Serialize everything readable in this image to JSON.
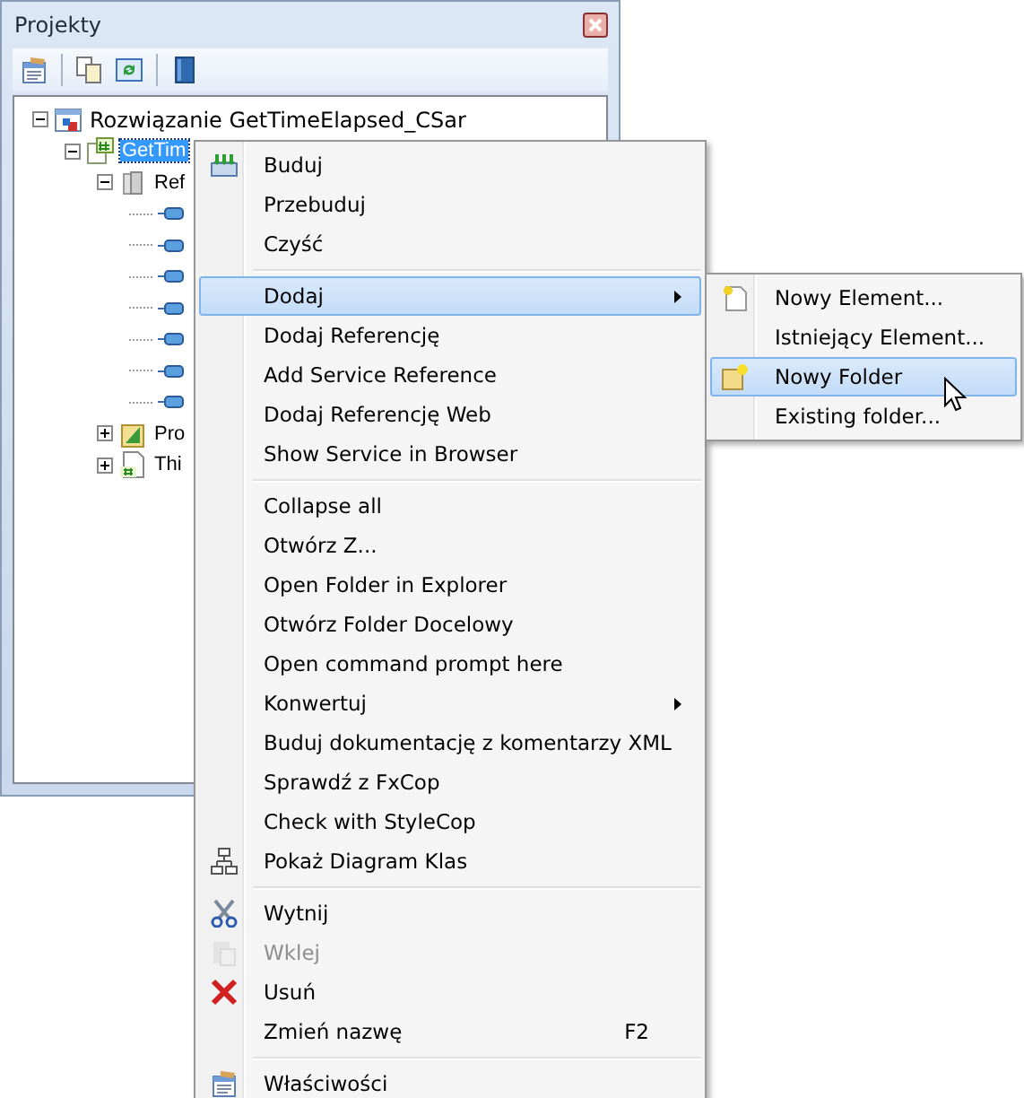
{
  "panel": {
    "title": "Projekty",
    "tree": [
      {
        "label": "Rozwiązanie GetTimeElapsed_CSar",
        "kind": "solution",
        "expanded": true,
        "selected": false,
        "children": [
          {
            "label": "GetTim",
            "kind": "project",
            "expanded": true,
            "selected": true,
            "children": [
              {
                "label": "Ref",
                "kind": "references",
                "expanded": true,
                "selected": false,
                "children": [
                  {
                    "kind": "reference"
                  },
                  {
                    "kind": "reference"
                  },
                  {
                    "kind": "reference"
                  },
                  {
                    "kind": "reference"
                  },
                  {
                    "kind": "reference"
                  },
                  {
                    "kind": "reference"
                  },
                  {
                    "kind": "reference"
                  }
                ]
              },
              {
                "label": "Pro",
                "kind": "properties",
                "expanded": false,
                "selected": false
              },
              {
                "label": "Thi",
                "kind": "file",
                "expanded": false,
                "selected": false
              }
            ]
          }
        ]
      }
    ]
  },
  "context_menu": [
    {
      "kind": "item",
      "label": "Buduj",
      "selected": false,
      "disabled": false,
      "submenu": false
    },
    {
      "kind": "item",
      "label": "Przebuduj",
      "selected": false,
      "disabled": false,
      "submenu": false
    },
    {
      "kind": "item",
      "label": "Czyść",
      "selected": false,
      "disabled": false,
      "submenu": false
    },
    {
      "kind": "separator"
    },
    {
      "kind": "item",
      "label": "Dodaj",
      "selected": true,
      "disabled": false,
      "submenu": true
    },
    {
      "kind": "item",
      "label": "Dodaj Referencję",
      "selected": false,
      "disabled": false,
      "submenu": false
    },
    {
      "kind": "item",
      "label": "Add Service Reference",
      "selected": false,
      "disabled": false,
      "submenu": false
    },
    {
      "kind": "item",
      "label": "Dodaj Referencję Web",
      "selected": false,
      "disabled": false,
      "submenu": false
    },
    {
      "kind": "item",
      "label": "Show Service in Browser",
      "selected": false,
      "disabled": false,
      "submenu": false
    },
    {
      "kind": "separator"
    },
    {
      "kind": "item",
      "label": "Collapse all",
      "selected": false,
      "disabled": false,
      "submenu": false
    },
    {
      "kind": "item",
      "label": "Otwórz Z...",
      "selected": false,
      "disabled": false,
      "submenu": false
    },
    {
      "kind": "item",
      "label": "Open Folder in Explorer",
      "selected": false,
      "disabled": false,
      "submenu": false
    },
    {
      "kind": "item",
      "label": "Otwórz Folder Docelowy",
      "selected": false,
      "disabled": false,
      "submenu": false
    },
    {
      "kind": "item",
      "label": "Open command prompt here",
      "selected": false,
      "disabled": false,
      "submenu": false
    },
    {
      "kind": "item",
      "label": "Konwertuj",
      "selected": false,
      "disabled": false,
      "submenu": true
    },
    {
      "kind": "item",
      "label": "Buduj dokumentację z komentarzy XML",
      "selected": false,
      "disabled": false,
      "submenu": false
    },
    {
      "kind": "item",
      "label": "Sprawdź z FxCop",
      "selected": false,
      "disabled": false,
      "submenu": false
    },
    {
      "kind": "item",
      "label": "Check with StyleCop",
      "selected": false,
      "disabled": false,
      "submenu": false
    },
    {
      "kind": "item",
      "label": "Pokaż Diagram Klas",
      "selected": false,
      "disabled": false,
      "submenu": false
    },
    {
      "kind": "separator"
    },
    {
      "kind": "item",
      "label": "Wytnij",
      "selected": false,
      "disabled": false,
      "submenu": false
    },
    {
      "kind": "item",
      "label": "Wklej",
      "selected": false,
      "disabled": true,
      "submenu": false
    },
    {
      "kind": "item",
      "label": "Usuń",
      "selected": false,
      "disabled": false,
      "submenu": false
    },
    {
      "kind": "item",
      "label": "Zmień nazwę",
      "shortcut": "F2",
      "selected": false,
      "disabled": false,
      "submenu": false
    },
    {
      "kind": "separator"
    },
    {
      "kind": "item",
      "label": "Właściwości",
      "selected": false,
      "disabled": false,
      "submenu": false
    }
  ],
  "submenu": [
    {
      "kind": "item",
      "label": "Nowy Element...",
      "selected": false,
      "disabled": false,
      "submenu": false
    },
    {
      "kind": "item",
      "label": "Istniejący Element...",
      "selected": false,
      "disabled": false,
      "submenu": false
    },
    {
      "kind": "item",
      "label": "Nowy Folder",
      "selected": true,
      "disabled": false,
      "submenu": false
    },
    {
      "kind": "item",
      "label": "Existing folder...",
      "selected": false,
      "disabled": false,
      "submenu": false
    }
  ]
}
